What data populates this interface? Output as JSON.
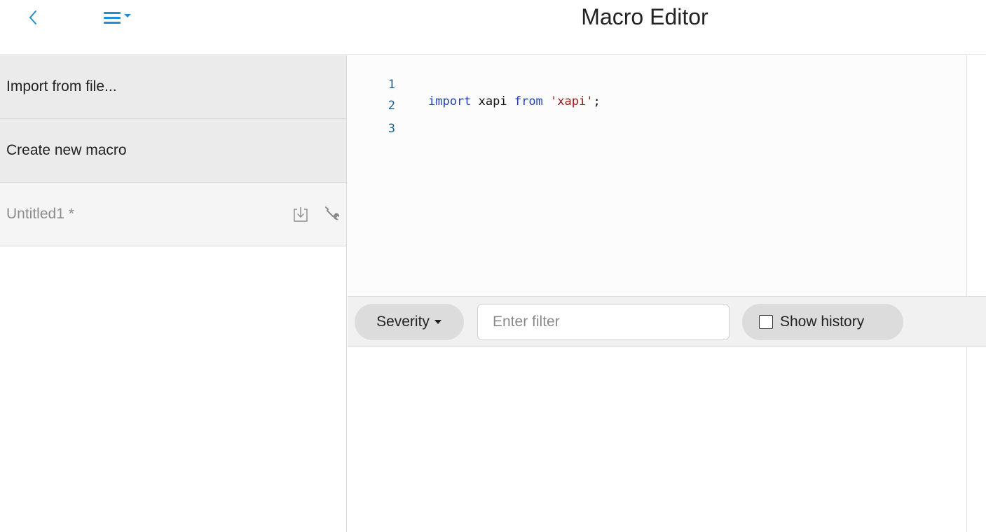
{
  "header": {
    "title": "Macro Editor",
    "back_icon": "chevron-left-icon",
    "menu_icon": "hamburger-menu-icon",
    "accent_color": "#1f8fd1"
  },
  "sidebar": {
    "actions": [
      {
        "label": "Import from file..."
      },
      {
        "label": "Create new macro"
      }
    ],
    "macros": [
      {
        "name": "Untitled1 *",
        "icons": [
          "save-download-icon",
          "wrench-icon"
        ]
      }
    ]
  },
  "editor": {
    "lines": [
      {
        "number": "1",
        "tokens": [
          {
            "text": "import",
            "type": "keyword"
          },
          {
            "text": " xapi ",
            "type": "plain"
          },
          {
            "text": "from",
            "type": "keyword"
          },
          {
            "text": " ",
            "type": "plain"
          },
          {
            "text": "'xapi'",
            "type": "string"
          },
          {
            "text": ";",
            "type": "plain"
          }
        ]
      },
      {
        "number": "2",
        "tokens": []
      },
      {
        "number": "3",
        "tokens": []
      }
    ]
  },
  "log_toolbar": {
    "severity_label": "Severity",
    "filter_placeholder": "Enter filter",
    "filter_value": "",
    "show_history_label": "Show history",
    "show_history_checked": false
  }
}
